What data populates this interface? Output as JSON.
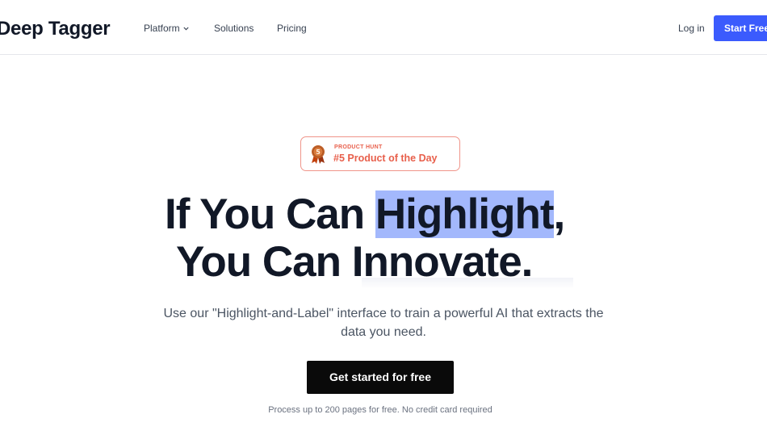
{
  "header": {
    "logo": "Deep Tagger",
    "nav": [
      "Platform",
      "Solutions",
      "Pricing"
    ],
    "login": "Log in",
    "cta": "Start Free"
  },
  "badge": {
    "small": "PRODUCT HUNT",
    "big": "#5 Product of the Day",
    "medal_number": "5",
    "medal_icon": "medal-icon"
  },
  "hero": {
    "line1_before": "If You Can ",
    "line1_highlight": "Highlight",
    "line1_after": ",",
    "line2": "You Can Innovate.",
    "subtitle": "Use our \"Highlight-and-Label\" interface to train a powerful AI that extracts the data you need.",
    "cta": "Get started for free",
    "note": "Process up to 200 pages for free. No credit card required"
  },
  "colors": {
    "accent": "#3b5bfd",
    "highlight": "#a3b8fc",
    "badge": "#e8604c"
  }
}
